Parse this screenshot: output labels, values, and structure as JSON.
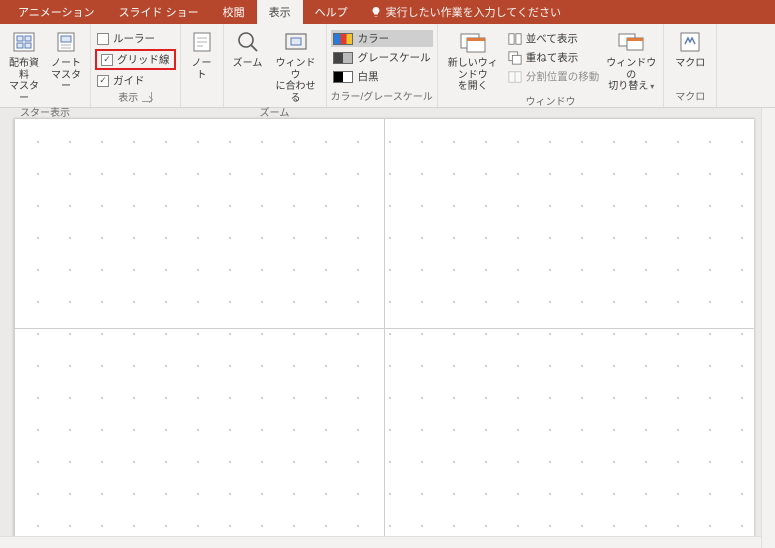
{
  "tabs": {
    "animation": "アニメーション",
    "slideshow": "スライド ショー",
    "review": "校閲",
    "view": "表示",
    "help": "ヘルプ",
    "tell_me": "実行したい作業を入力してください"
  },
  "groups": {
    "master_views": {
      "label": "スター表示",
      "handout_master": "配布資料\nマスター",
      "notes_master": "ノート\nマスター"
    },
    "show": {
      "label": "表示",
      "ruler": "ルーラー",
      "gridlines": "グリッド線",
      "guides": "ガイド"
    },
    "notes": {
      "btn": "ノー\nト"
    },
    "zoom": {
      "label": "ズーム",
      "zoom": "ズーム",
      "fit": "ウィンドウ\nに合わせる"
    },
    "colorgray": {
      "label": "カラー/グレースケール",
      "color": "カラー",
      "grayscale": "グレースケール",
      "bw": "白黒"
    },
    "window": {
      "label": "ウィンドウ",
      "new_window": "新しいウィンドウ\nを開く",
      "arrange_all": "並べて表示",
      "cascade": "重ねて表示",
      "move_split": "分割位置の移動",
      "switch": "ウィンドウの\n切り替え"
    },
    "macro": {
      "label": "マクロ",
      "btn": "マクロ"
    }
  }
}
